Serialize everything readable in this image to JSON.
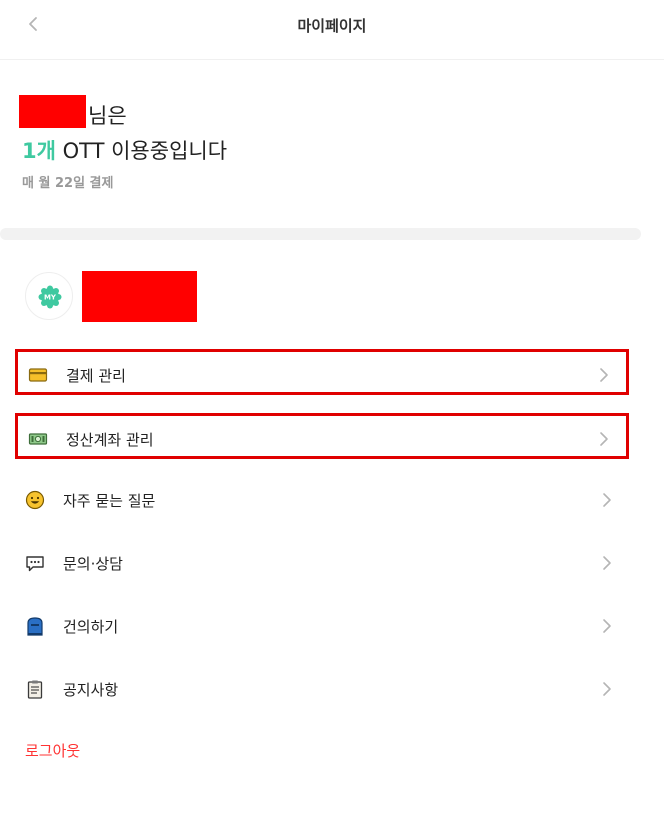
{
  "header": {
    "title": "마이페이지",
    "back_icon": "chevron-left-icon"
  },
  "summary": {
    "name_suffix": "님은",
    "ott_count": "1개",
    "ott_text": " OTT 이용중입니다",
    "billing_text": "매 월 22일 결제",
    "accent_color": "#3fc9a0"
  },
  "profile": {
    "badge_text": "MY",
    "badge_color": "#3fc9a0"
  },
  "menu": [
    {
      "label": "결제 관리",
      "icon": "credit-card-icon",
      "highlighted": true
    },
    {
      "label": "정산계좌 관리",
      "icon": "money-bill-icon",
      "highlighted": true
    },
    {
      "label": "자주 묻는 질문",
      "icon": "smile-face-icon",
      "highlighted": false
    },
    {
      "label": "문의·상담",
      "icon": "speech-bubble-icon",
      "highlighted": false
    },
    {
      "label": "건의하기",
      "icon": "mailbox-icon",
      "highlighted": false
    },
    {
      "label": "공지사항",
      "icon": "clipboard-icon",
      "highlighted": false
    }
  ],
  "logout": {
    "label": "로그아웃",
    "color": "#ff3333"
  }
}
